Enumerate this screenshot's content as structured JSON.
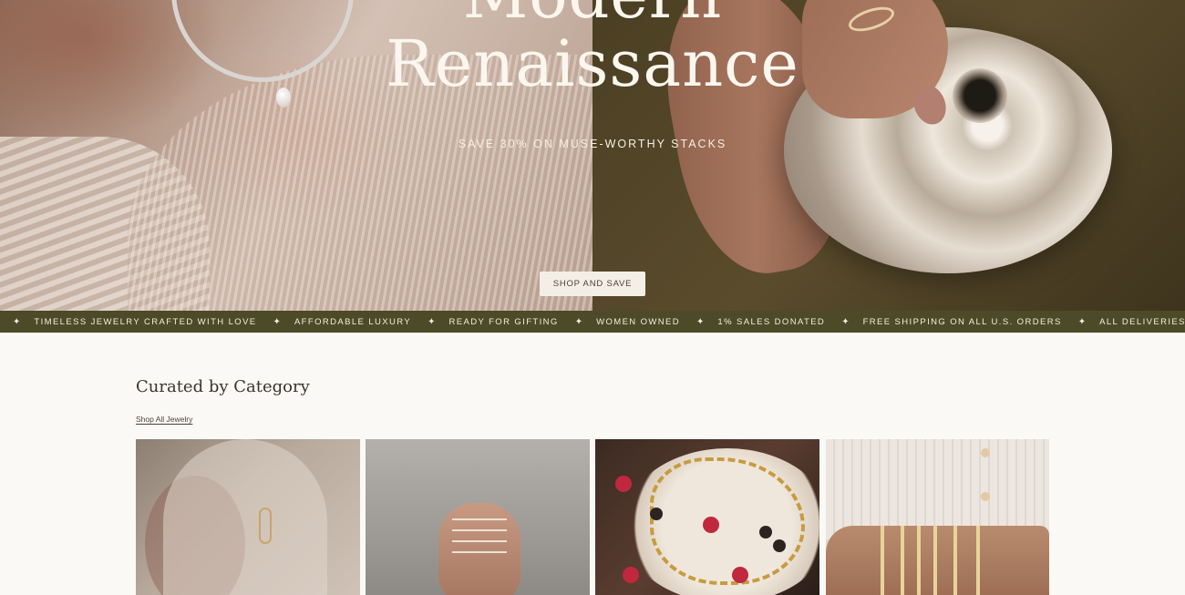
{
  "hero": {
    "headline_line1": "Modern",
    "headline_line2": "Renaissance",
    "subhead": "SAVE 30% ON MUSE-WORTHY STACKS",
    "cta_label": "SHOP AND SAVE"
  },
  "marquee": {
    "separator": "✦",
    "messages": [
      "TIMELESS JEWELRY CRAFTED WITH LOVE",
      "AFFORDABLE LUXURY",
      "READY FOR GIFTING",
      "WOMEN OWNED",
      "1% SALES DONATED",
      "FREE SHIPPING ON ALL U.S. ORDERS",
      "ALL DELIVERIES CARBON NEUTRAL"
    ]
  },
  "category_section": {
    "title": "Curated by Category",
    "shop_all_link": "Shop All Jewelry"
  },
  "colors": {
    "page_background": "#fbf9f5",
    "marquee_background": "#4d4a27",
    "cta_background": "#f4efe6",
    "text_dark": "#3a342d"
  }
}
